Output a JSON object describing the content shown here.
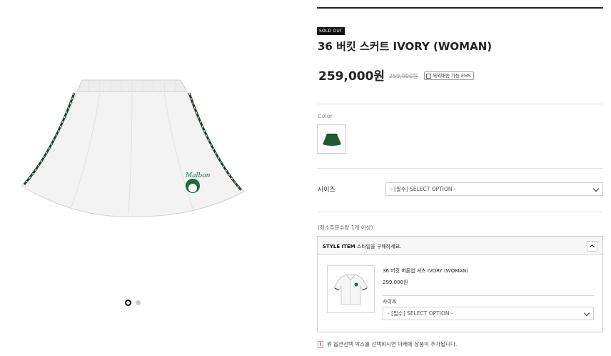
{
  "gallery": {
    "product_logo": "Malbon",
    "slides": [
      {
        "active": true
      },
      {
        "active": false
      }
    ]
  },
  "product": {
    "soldout_badge": "SOLD OUT",
    "title": "36 버킷 스커트 IVORY (WOMAN)",
    "price": "259,000원",
    "original_price": "259,000원",
    "ems_badge": "해외배송 가능 EMS"
  },
  "color": {
    "label": "Color",
    "swatch_color": "#1f5a32"
  },
  "size": {
    "label": "사이즈",
    "select_value": "- [필수] SELECT OPTION -"
  },
  "min_order": "(최소주문수량 1개 이상)",
  "style_item": {
    "title_bold": "STYLE ITEM",
    "title_rest": " 스타일을 구매하세요.",
    "product_name": "36 버킷 버튼업 셔츠 IVORY (WOMAN)",
    "product_price": "299,000원",
    "size_label": "사이즈",
    "size_select_value": "- [필수] SELECT OPTION -"
  },
  "notice": {
    "icon": "!",
    "text": "위 옵션선택 박스를 선택하시면 아래에 상품이 추가됩니다."
  }
}
